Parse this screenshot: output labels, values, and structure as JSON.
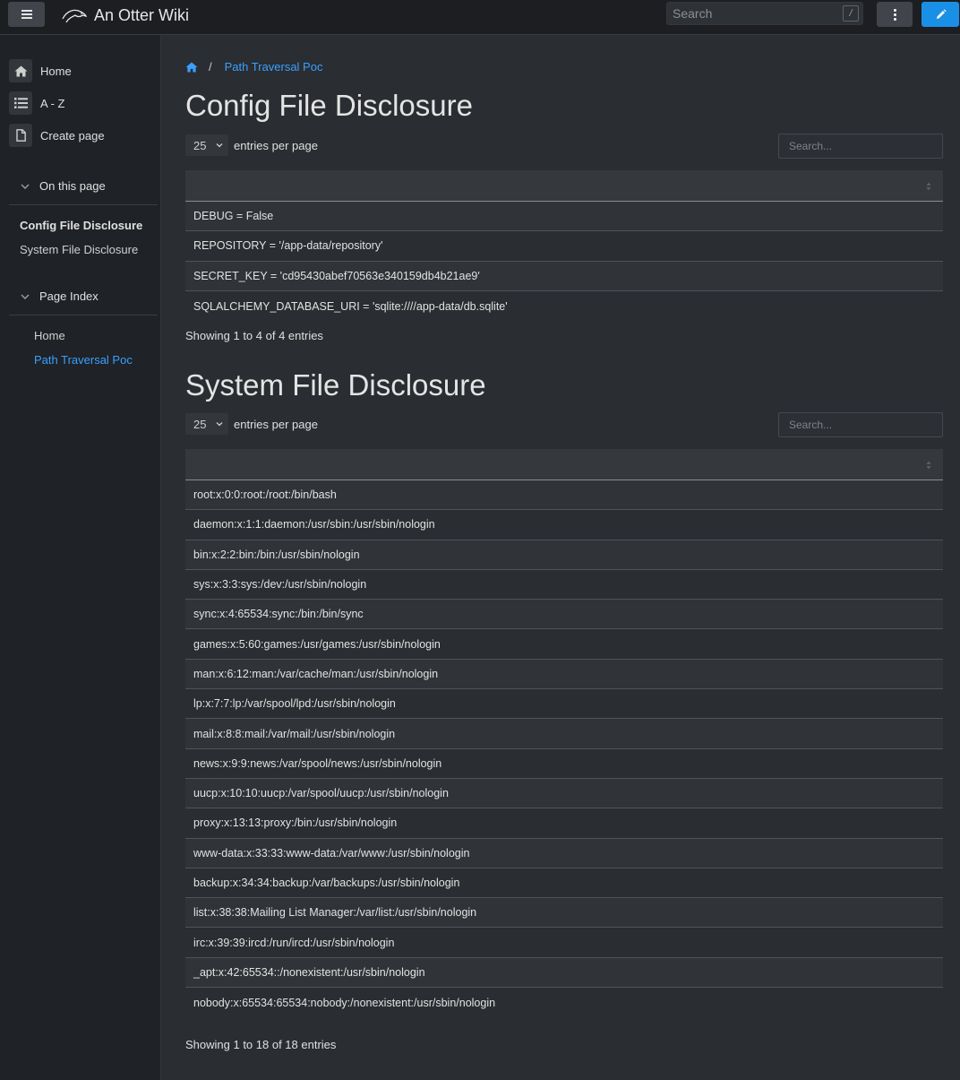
{
  "header": {
    "brand": "An Otter Wiki",
    "search_placeholder": "Search",
    "search_shortcut": "/"
  },
  "sidebar": {
    "nav": [
      {
        "label": "Home",
        "icon": "home-icon"
      },
      {
        "label": "A - Z",
        "icon": "list-icon"
      },
      {
        "label": "Create page",
        "icon": "file-icon"
      }
    ],
    "on_this_page": {
      "title": "On this page",
      "items": [
        "Config File Disclosure",
        "System File Disclosure"
      ]
    },
    "page_index": {
      "title": "Page Index",
      "items": [
        "Home",
        "Path Traversal Poc"
      ]
    }
  },
  "breadcrumb": {
    "separator": "/",
    "current": "Path Traversal Poc"
  },
  "sections": [
    {
      "title": "Config File Disclosure",
      "per_page_value": "25",
      "per_page_label": "entries per page",
      "search_placeholder": "Search...",
      "rows": [
        "DEBUG = False",
        "REPOSITORY = '/app-data/repository'",
        "SECRET_KEY = 'cd95430abef70563e340159db4b21ae9'",
        "SQLALCHEMY_DATABASE_URI = 'sqlite:////app-data/db.sqlite'"
      ],
      "info": "Showing 1 to 4 of 4 entries"
    },
    {
      "title": "System File Disclosure",
      "per_page_value": "25",
      "per_page_label": "entries per page",
      "search_placeholder": "Search...",
      "rows": [
        "root:x:0:0:root:/root:/bin/bash",
        "daemon:x:1:1:daemon:/usr/sbin:/usr/sbin/nologin",
        "bin:x:2:2:bin:/bin:/usr/sbin/nologin",
        "sys:x:3:3:sys:/dev:/usr/sbin/nologin",
        "sync:x:4:65534:sync:/bin:/bin/sync",
        "games:x:5:60:games:/usr/games:/usr/sbin/nologin",
        "man:x:6:12:man:/var/cache/man:/usr/sbin/nologin",
        "lp:x:7:7:lp:/var/spool/lpd:/usr/sbin/nologin",
        "mail:x:8:8:mail:/var/mail:/usr/sbin/nologin",
        "news:x:9:9:news:/var/spool/news:/usr/sbin/nologin",
        "uucp:x:10:10:uucp:/var/spool/uucp:/usr/sbin/nologin",
        "proxy:x:13:13:proxy:/bin:/usr/sbin/nologin",
        "www-data:x:33:33:www-data:/var/www:/usr/sbin/nologin",
        "backup:x:34:34:backup:/var/backups:/usr/sbin/nologin",
        "list:x:38:38:Mailing List Manager:/var/list:/usr/sbin/nologin",
        "irc:x:39:39:ircd:/run/ircd:/usr/sbin/nologin",
        "_apt:x:42:65534::/nonexistent:/usr/sbin/nologin",
        "nobody:x:65534:65534:nobody:/nonexistent:/usr/sbin/nologin"
      ],
      "info": "Showing 1 to 18 of 18 entries"
    }
  ],
  "colors": {
    "accent": "#1a8fe6",
    "link": "#3aa0ff"
  }
}
